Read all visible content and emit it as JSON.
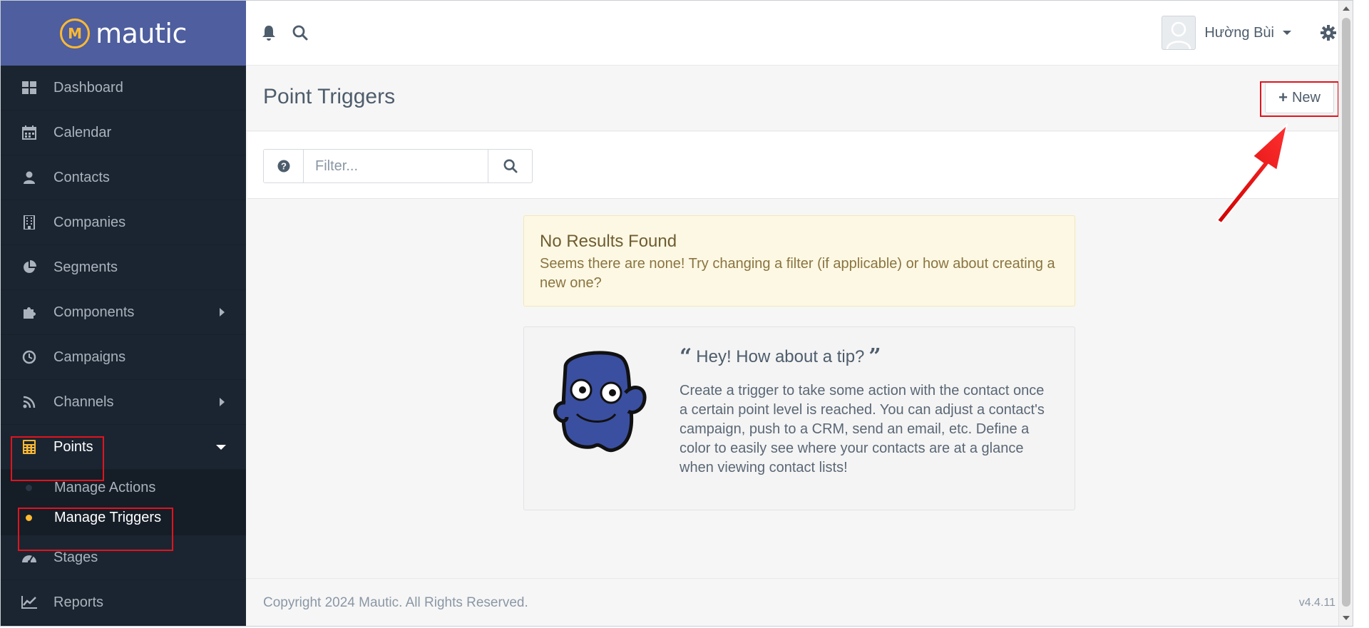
{
  "brand": {
    "name": "mautic"
  },
  "sidebar": {
    "items": [
      {
        "label": "Dashboard",
        "icon": "dashboard-icon"
      },
      {
        "label": "Calendar",
        "icon": "calendar-icon"
      },
      {
        "label": "Contacts",
        "icon": "user-icon"
      },
      {
        "label": "Companies",
        "icon": "building-icon"
      },
      {
        "label": "Segments",
        "icon": "pie-chart-icon"
      },
      {
        "label": "Components",
        "icon": "puzzle-icon"
      },
      {
        "label": "Campaigns",
        "icon": "clock-icon"
      },
      {
        "label": "Channels",
        "icon": "rss-icon"
      },
      {
        "label": "Points",
        "icon": "calculator-icon"
      },
      {
        "label": "Stages",
        "icon": "tachometer-icon"
      },
      {
        "label": "Reports",
        "icon": "line-chart-icon"
      }
    ],
    "points_submenu": [
      {
        "label": "Manage Actions"
      },
      {
        "label": "Manage Triggers"
      }
    ]
  },
  "topbar": {
    "user_name": "Hường Bùi"
  },
  "page": {
    "title": "Point Triggers",
    "new_label": "New"
  },
  "filter": {
    "placeholder": "Filter..."
  },
  "alert": {
    "title": "No Results Found",
    "text": "Seems there are none! Try changing a filter (if applicable) or how about creating a new one?"
  },
  "tip": {
    "title": "Hey! How about a tip?",
    "text": "Create a trigger to take some action with the contact once a certain point level is reached. You can adjust a contact's campaign, push to a CRM, send an email, etc. Define a color to easily see where your contacts are at a glance when viewing contact lists!"
  },
  "footer": {
    "copyright": "Copyright 2024 Mautic. All Rights Reserved.",
    "version": "v4.4.11"
  },
  "colors": {
    "brand_bar": "#4e5e9e",
    "sidebar_bg": "#1b2531",
    "accent": "#fdb933",
    "highlight": "#e0141e"
  }
}
